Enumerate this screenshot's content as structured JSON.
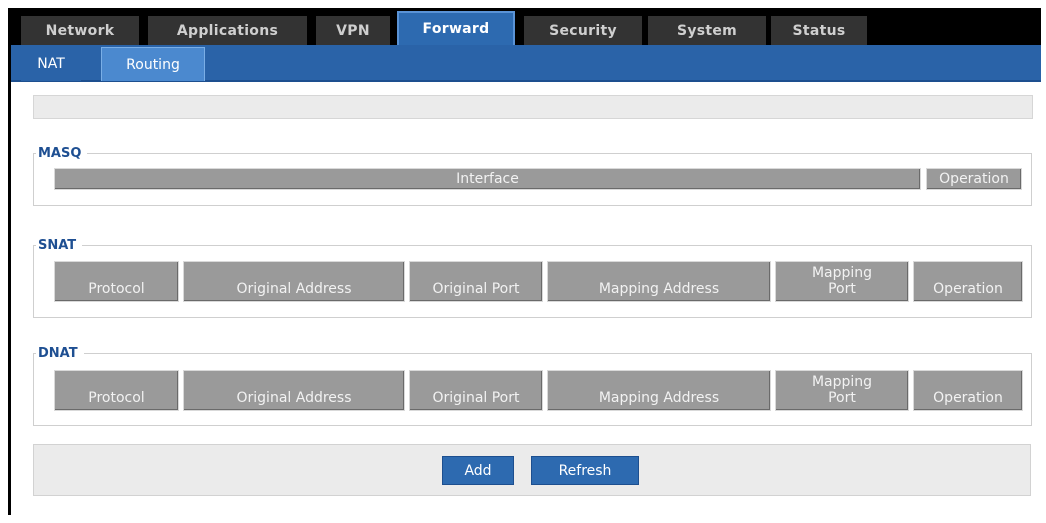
{
  "nav": {
    "tabs": [
      {
        "label": "Network",
        "active": false
      },
      {
        "label": "Applications",
        "active": false
      },
      {
        "label": "VPN",
        "active": false
      },
      {
        "label": "Forward",
        "active": true
      },
      {
        "label": "Security",
        "active": false
      },
      {
        "label": "System",
        "active": false
      },
      {
        "label": "Status",
        "active": false
      }
    ]
  },
  "subnav": {
    "tabs": [
      {
        "label": "NAT",
        "selected": true
      },
      {
        "label": "Routing",
        "selected": false
      }
    ]
  },
  "masq": {
    "legend": "MASQ",
    "columns": [
      "Interface",
      "Operation"
    ]
  },
  "snat": {
    "legend": "SNAT",
    "columns": [
      "Protocol",
      "Original Address",
      "Original Port",
      "Mapping Address",
      "Mapping Port",
      "Operation"
    ]
  },
  "dnat": {
    "legend": "DNAT",
    "columns": [
      "Protocol",
      "Original Address",
      "Original Port",
      "Mapping Address",
      "Mapping Port",
      "Operation"
    ]
  },
  "actions": {
    "add_label": "Add",
    "refresh_label": "Refresh"
  },
  "colors": {
    "accent": "#2d6ab0",
    "header_bg": "#9a9a9a",
    "legend": "#1e4f92"
  }
}
